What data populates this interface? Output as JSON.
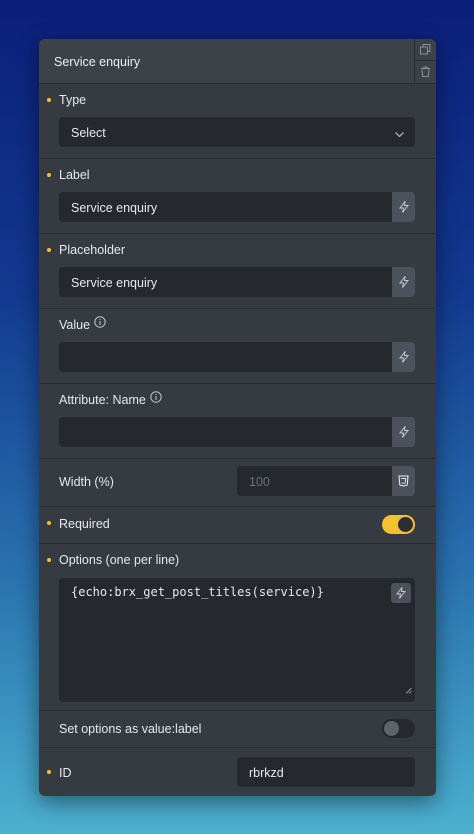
{
  "panel": {
    "title": "Service enquiry"
  },
  "fields": {
    "type": {
      "label": "Type",
      "value": "Select"
    },
    "label_field": {
      "label": "Label",
      "value": "Service enquiry"
    },
    "placeholder": {
      "label": "Placeholder",
      "value": "Service enquiry"
    },
    "value": {
      "label": "Value",
      "value": ""
    },
    "attribute_name": {
      "label": "Attribute: Name",
      "value": ""
    },
    "width": {
      "label": "Width (%)",
      "placeholder": "100"
    },
    "required": {
      "label": "Required",
      "checked": true
    },
    "options": {
      "label": "Options (one per line)",
      "value": "{echo:brx_get_post_titles(service)}"
    },
    "set_options": {
      "label": "Set options as value:label",
      "checked": false
    },
    "id": {
      "label": "ID",
      "value": "rbrkzd"
    }
  },
  "colors": {
    "accent": "#f3c233",
    "panel": "#363b42",
    "input": "#25282d"
  },
  "icons": [
    "copy-icon",
    "trash-icon",
    "chevron-down-icon",
    "lightning-icon",
    "info-icon",
    "css3-icon",
    "resize-handle-icon"
  ]
}
